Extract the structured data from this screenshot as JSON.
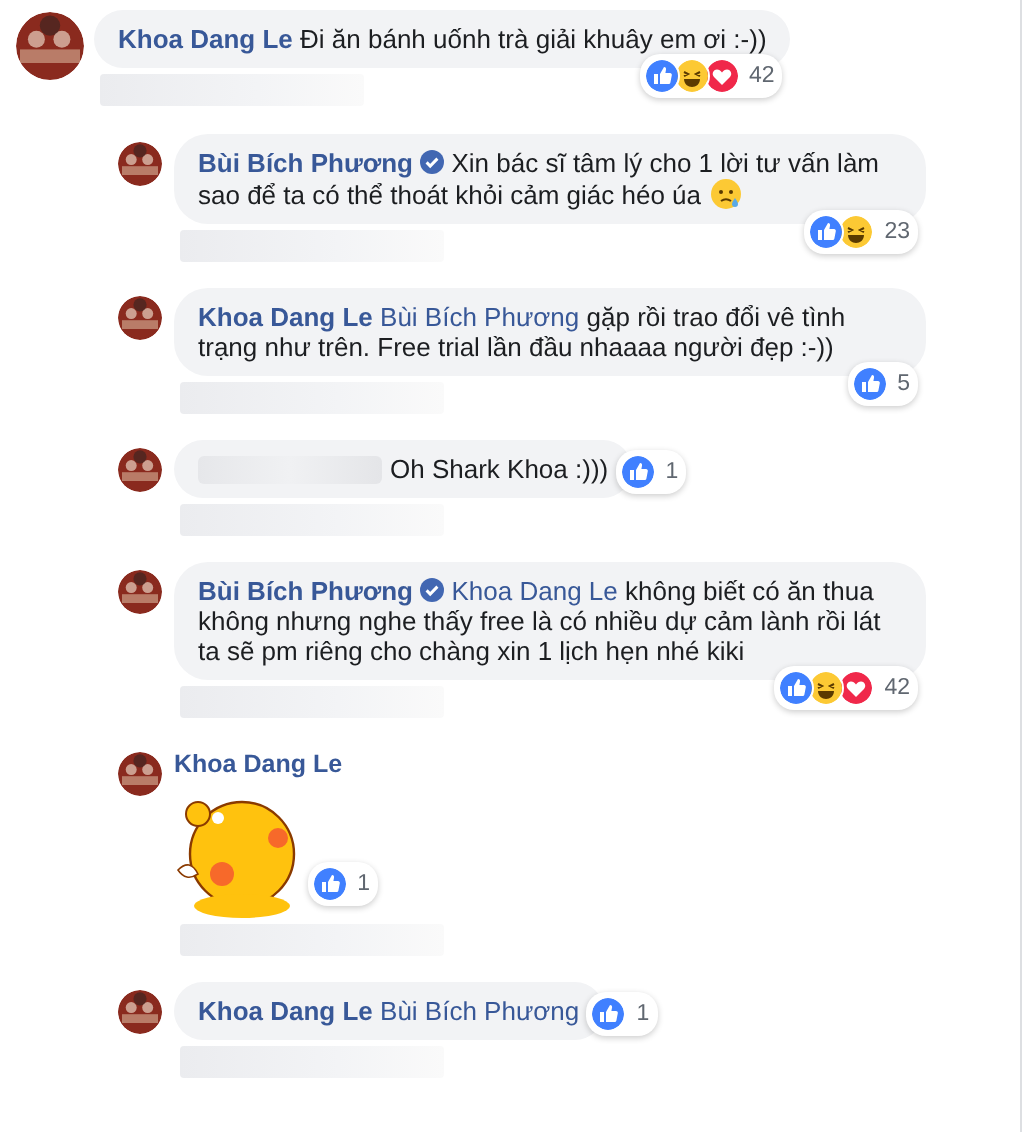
{
  "comments": [
    {
      "kind": "text",
      "author": "Khoa Dang Le",
      "verified": false,
      "text": "Đi ăn bánh uốnh trà giải khuây em ơi :-))",
      "reactions": [
        {
          "kind": "like"
        },
        {
          "kind": "haha"
        },
        {
          "kind": "love"
        }
      ],
      "count": "42",
      "children": [
        {
          "kind": "text",
          "author": "Bùi Bích Phương",
          "verified": true,
          "text": "Xin bác sĩ tâm lý cho 1 lời tư vấn làm sao để ta có thể thoát khỏi cảm giác héo úa",
          "emoji": {
            "kind": "sad-sweat"
          },
          "reactions": [
            {
              "kind": "like"
            },
            {
              "kind": "haha"
            }
          ],
          "count": "23"
        },
        {
          "kind": "text",
          "author": "Khoa Dang Le",
          "verified": false,
          "mention": "Bùi Bích Phương",
          "text": "gặp rồi trao đổi vê tình trạng như trên. Free trial lần đầu nhaaaa người đẹp :-))",
          "reactions": [
            {
              "kind": "like"
            }
          ],
          "count": "5"
        },
        {
          "kind": "text",
          "author_hidden": true,
          "verified": false,
          "text": "Oh Shark Khoa :)))",
          "reactions": [
            {
              "kind": "like"
            }
          ],
          "count": "1"
        },
        {
          "kind": "text",
          "author": "Bùi Bích Phương",
          "verified": true,
          "mention": "Khoa Dang Le",
          "text": "không biết có ăn thua không nhưng nghe thấy free là có nhiều dự cảm lành rồi lát ta sẽ pm riêng cho chàng xin 1 lịch hẹn nhé kiki",
          "reactions": [
            {
              "kind": "like"
            },
            {
              "kind": "haha"
            },
            {
              "kind": "love"
            }
          ],
          "count": "42"
        },
        {
          "kind": "sticker",
          "author": "Khoa Dang Le",
          "verified": false,
          "reactions": [
            {
              "kind": "like"
            }
          ],
          "count": "1"
        },
        {
          "kind": "text",
          "author": "Khoa Dang Le",
          "verified": false,
          "mention": "Bùi Bích Phương",
          "reactions": [
            {
              "kind": "like"
            }
          ],
          "count": "1"
        }
      ]
    }
  ]
}
